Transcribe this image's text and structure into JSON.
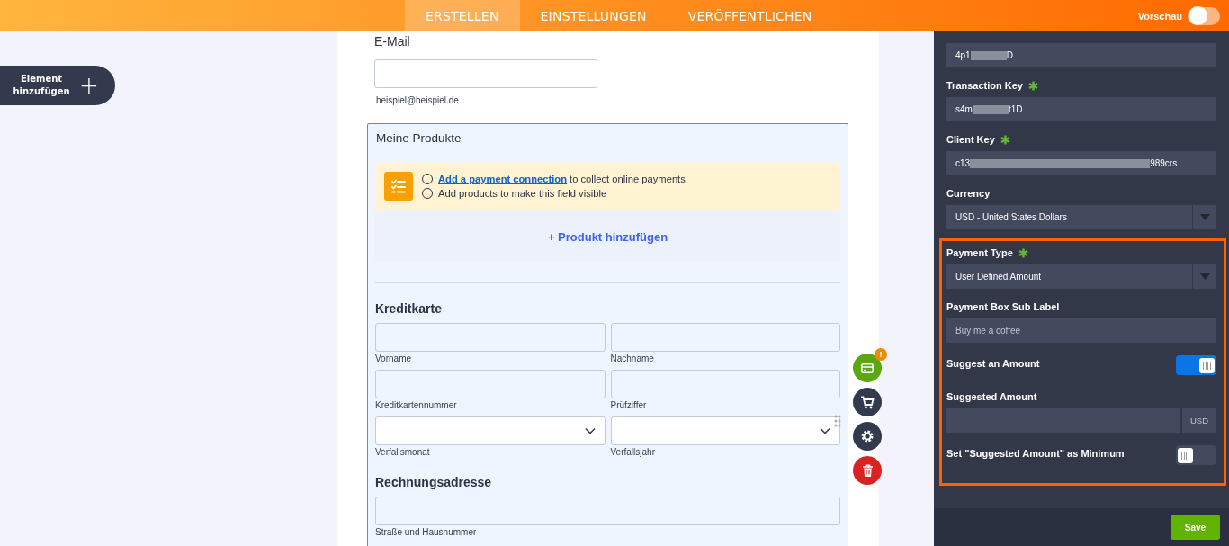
{
  "top_bar": {
    "tabs": [
      {
        "label": "ERSTELLEN",
        "selected": true
      },
      {
        "label": "EINSTELLUNGEN",
        "selected": false
      },
      {
        "label": "VERÖFFENTLICHEN",
        "selected": false
      }
    ],
    "preview": {
      "label": "Vorschau",
      "on": false
    }
  },
  "add_element": {
    "label": "Element hinzufügen",
    "icon": "+"
  },
  "form": {
    "email": {
      "label": "E-Mail",
      "sublabel": "beispiel@beispiel.de"
    },
    "products": {
      "title": "Meine Produkte",
      "notice": [
        {
          "link": "Add a payment connection",
          "text": " to collect online payments",
          "checked": false
        },
        {
          "text": "Add products to make this field visible",
          "checked": false
        }
      ],
      "add_product": "+ Produkt hinzufügen"
    },
    "credit_card": {
      "title": "Kreditkarte",
      "fields": [
        {
          "label": "Vorname",
          "kind": "text"
        },
        {
          "label": "Nachname",
          "kind": "text"
        },
        {
          "label": "Kreditkartennummer",
          "kind": "text"
        },
        {
          "label": "Prüfziffer",
          "kind": "text"
        },
        {
          "label": "Verfallsmonat",
          "kind": "select"
        },
        {
          "label": "Verfallsjahr",
          "kind": "select"
        }
      ]
    },
    "billing": {
      "title": "Rechnungsadresse",
      "fields": [
        {
          "label": "Straße und Hausnummer",
          "kind": "text"
        }
      ]
    },
    "tools": [
      {
        "kind": "card",
        "badge": "!"
      },
      {
        "kind": "cart"
      },
      {
        "kind": "settings"
      },
      {
        "kind": "delete"
      }
    ]
  },
  "panel": {
    "fields": [
      {
        "kind": "masked",
        "value_start": "4p1",
        "value_end": "D"
      },
      {
        "kind": "masked",
        "label": "Transaction Key",
        "required": true,
        "value_start": "s4m",
        "value_end": "t1D"
      },
      {
        "kind": "masked",
        "label": "Client Key",
        "required": true,
        "value_start": "c13",
        "value_end": "989crs"
      },
      {
        "kind": "select",
        "label": "Currency",
        "value": "USD - United States Dollars"
      }
    ],
    "highlighted": [
      {
        "kind": "select",
        "label": "Payment Type",
        "required": true,
        "value": "User Defined Amount"
      },
      {
        "kind": "text",
        "label": "Payment Box Sub Label",
        "placeholder": "Buy me a coffee"
      },
      {
        "kind": "toggle",
        "label": "Suggest an Amount",
        "on": true
      },
      {
        "kind": "amount",
        "label": "Suggested Amount",
        "unit": "USD"
      },
      {
        "kind": "toggle",
        "label": "Set \"Suggested Amount\" as Minimum",
        "on": false
      }
    ],
    "save": "Save"
  }
}
